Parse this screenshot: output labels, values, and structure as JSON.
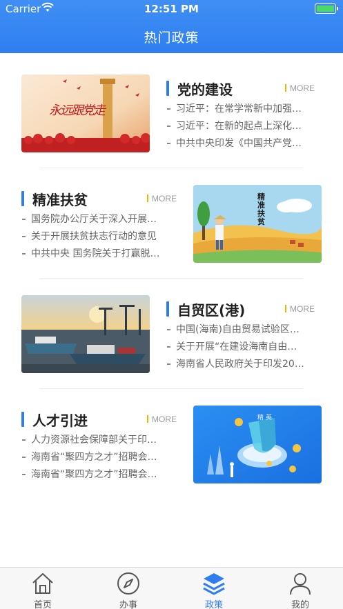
{
  "status_bar": {
    "carrier": "Carrier",
    "time": "12:51 PM"
  },
  "header": {
    "title": "热门政策"
  },
  "more_label": "MORE",
  "sections": [
    {
      "title": "党的建设",
      "image_text": "永远跟党走",
      "items": [
        "习近平：在常学常新中加强…",
        "习近平：在新的起点上深化…",
        "中共中央印发《中国共产党…"
      ]
    },
    {
      "title": "精准扶贫",
      "image_text": "精准扶贫",
      "items": [
        "国务院办公厅关于深入开展…",
        "关于开展扶贫扶志行动的意见",
        "中共中央 国务院关于打赢脱…"
      ]
    },
    {
      "title": "自贸区(港)",
      "items": [
        "中国(海南)自由贸易试验区…",
        "关于开展“在建设海南自由…",
        "海南省人民政府关于印发20…"
      ]
    },
    {
      "title": "人才引进",
      "image_text": "精英",
      "items": [
        "人力资源社会保障部关于印…",
        "海南省“聚四方之才”招聘会…",
        "海南省“聚四方之才”招聘会…"
      ]
    }
  ],
  "tabs": [
    {
      "label": "首页",
      "icon": "home-icon",
      "active": false
    },
    {
      "label": "办事",
      "icon": "compass-icon",
      "active": false
    },
    {
      "label": "政策",
      "icon": "layers-icon",
      "active": true
    },
    {
      "label": "我的",
      "icon": "user-icon",
      "active": false
    }
  ],
  "colors": {
    "primary": "#2f7ef0",
    "accent": "#f3b400"
  }
}
